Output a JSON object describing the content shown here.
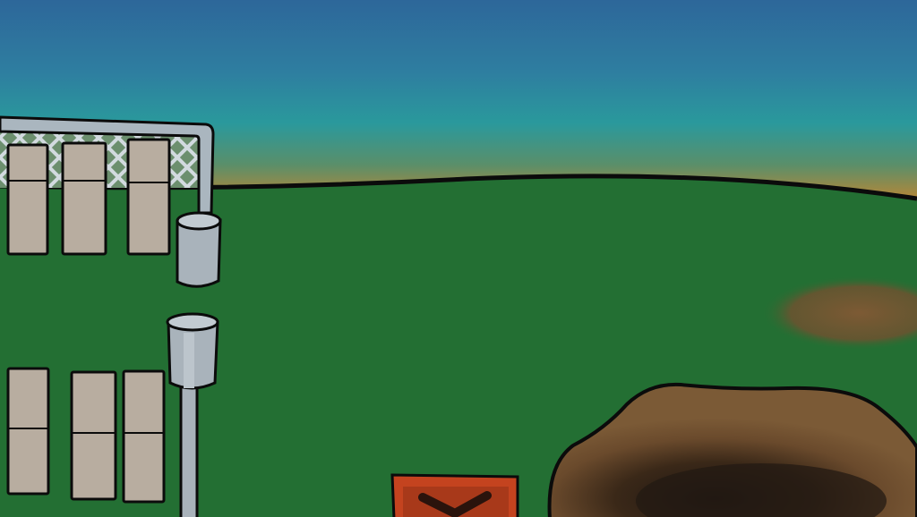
{
  "scene": {
    "sky_colors": {
      "top": "#2e6f9c",
      "middle": "#2a9a9c",
      "horizon": "#c7852e"
    },
    "ground_color": "#236f33",
    "outline_color": "#0b0b0b",
    "elements": {
      "fence": {
        "color": "#aab6bf",
        "mesh_color": "#c5ced4"
      },
      "panels": {
        "color": "#b8ada0",
        "top_row_count": 3,
        "bottom_row_count": 3
      },
      "trash_cans": {
        "color": "#a9b3bb",
        "count": 2
      },
      "dirt_patches": {
        "color": "#7a5630",
        "count": 2
      },
      "crater": {
        "color": "#2e1f14"
      },
      "sign": {
        "color": "#c4431f",
        "inner_color": "#a8391a",
        "arrow_icon": "chevron-down-icon"
      }
    }
  }
}
